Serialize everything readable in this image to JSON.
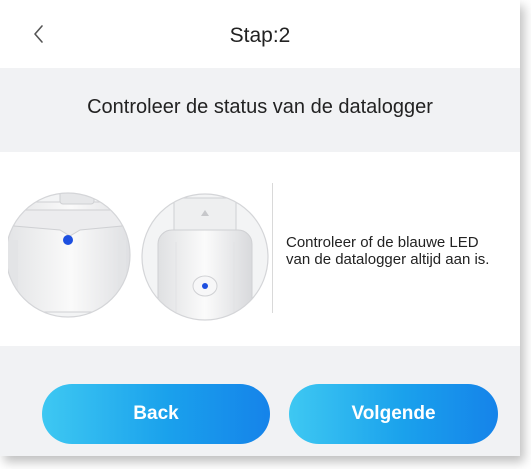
{
  "header": {
    "back_icon": "chevron-left-icon",
    "title": "Stap:2"
  },
  "step": {
    "heading": "Controleer de status van de datalogger"
  },
  "instruction": {
    "line1": "Controleer of de blauwe LED",
    "line2": "van de datalogger altijd aan is."
  },
  "buttons": {
    "back_label": "Back",
    "next_label": "Volgende"
  },
  "colors": {
    "background": "#f1f2f4",
    "accent_start": "#3ec8f2",
    "accent_end": "#1583ea",
    "led": "#1d4fe0"
  }
}
